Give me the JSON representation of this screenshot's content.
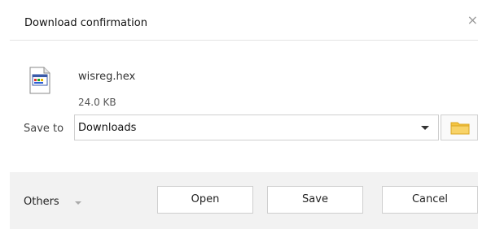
{
  "dialog": {
    "title": "Download confirmation",
    "close_glyph": "×"
  },
  "file": {
    "name": "wisreg.hex",
    "size": "24.0 KB",
    "icon": "file-hex-icon"
  },
  "save_to": {
    "label": "Save to",
    "selected": "Downloads",
    "folder_icon": "folder-icon",
    "folder_color": "#f5c542"
  },
  "footer": {
    "others_label": "Others",
    "buttons": {
      "open": "Open",
      "save": "Save",
      "cancel": "Cancel"
    }
  }
}
